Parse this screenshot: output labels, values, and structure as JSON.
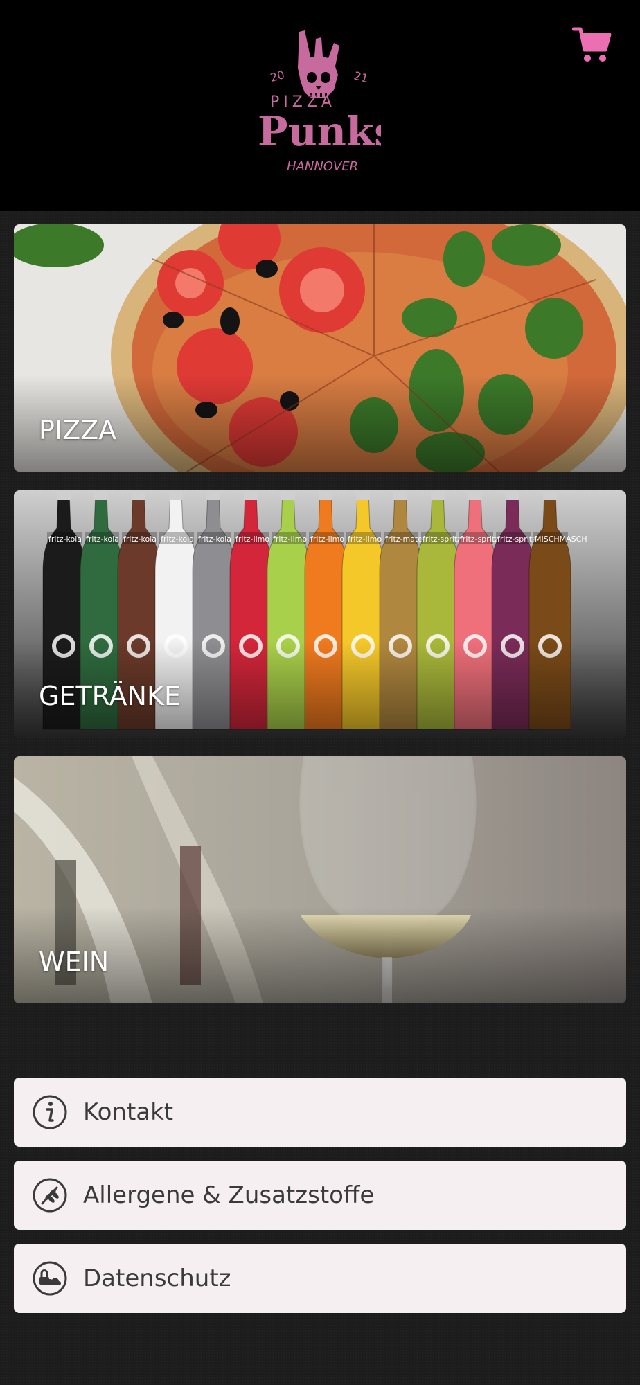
{
  "header": {
    "logo": {
      "year_left": "20",
      "year_right": "21",
      "word_top": "PIZZA",
      "word_main": "Punks",
      "city": "HANNOVER"
    },
    "cart_icon": "shopping-cart-icon"
  },
  "categories": [
    {
      "label": "PIZZA"
    },
    {
      "label": "GETRÄNKE"
    },
    {
      "label": "WEIN"
    }
  ],
  "links": [
    {
      "label": "Kontakt",
      "icon": "info-icon"
    },
    {
      "label": "Allergene & Zusatzstoffe",
      "icon": "wheat-icon"
    },
    {
      "label": "Datenschutz",
      "icon": "lock-cloud-icon"
    }
  ],
  "colors": {
    "accent": "#ec6fb4",
    "logo": "#c76a9d",
    "header_bg": "#000000",
    "card_bg": "#f6eff2"
  },
  "bottle_labels": [
    "fritz-kola",
    "fritz-kola",
    "fritz-kola",
    "fritz-kola",
    "fritz-kola",
    "fritz-limo",
    "fritz-limo",
    "fritz-limo",
    "fritz-limo",
    "fritz-mate",
    "fritz-spritz",
    "fritz-spritz",
    "fritz-spritz",
    "MISCHMASCH"
  ]
}
